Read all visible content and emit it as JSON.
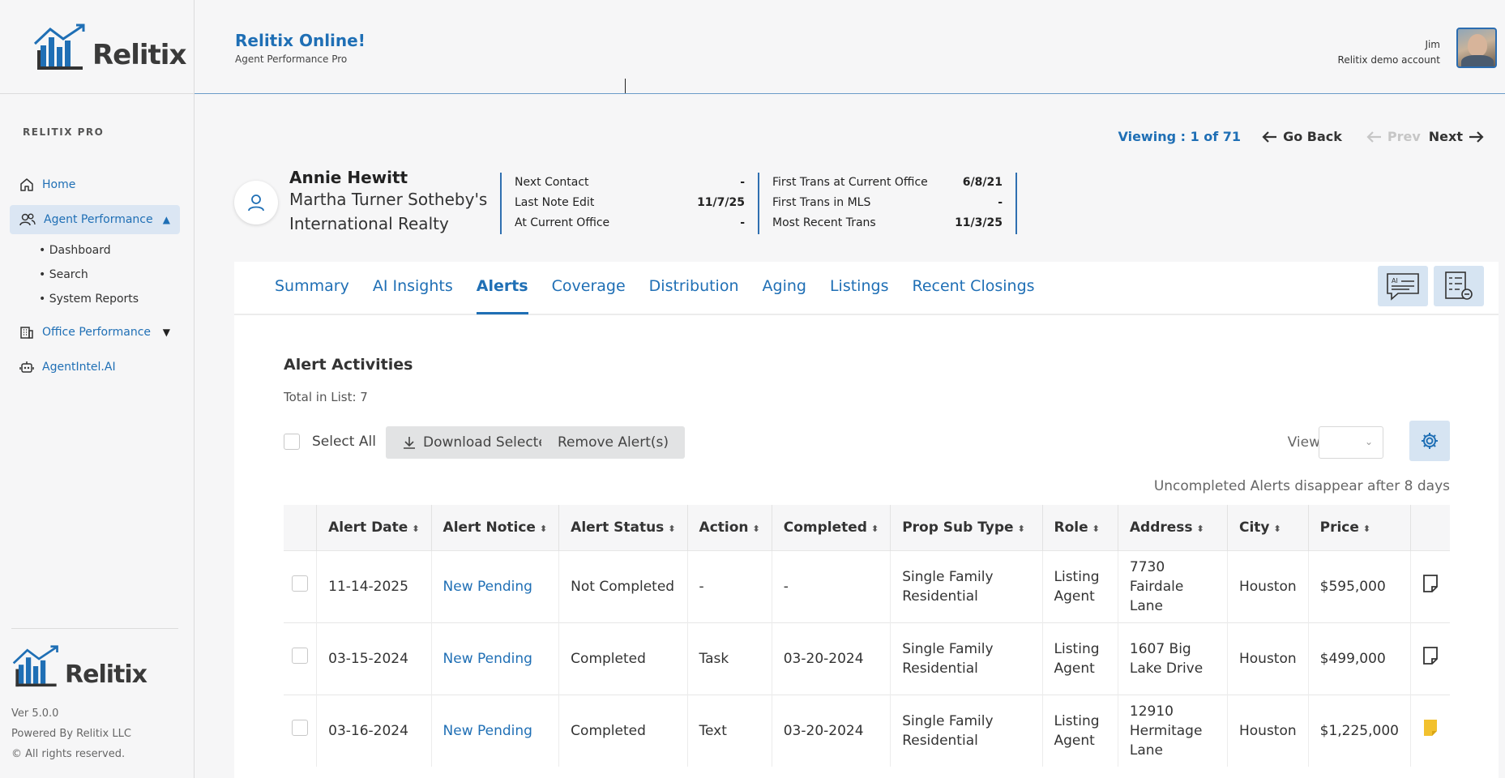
{
  "brand": {
    "logo_text": "Relitix"
  },
  "header": {
    "app_title": "Relitix Online!",
    "app_subtitle": "Agent Performance Pro",
    "user_name": "Jim",
    "user_account": "Relitix demo account"
  },
  "sidebar": {
    "section_title": "RELITIX PRO",
    "items": [
      {
        "label": "Home",
        "icon": "home-icon"
      },
      {
        "label": "Agent Performance",
        "icon": "users-icon",
        "expanded": true
      },
      {
        "label": "Office Performance",
        "icon": "building-icon",
        "expanded": false
      },
      {
        "label": "AgentIntel.AI",
        "icon": "robot-icon"
      }
    ],
    "sub_items": [
      "• Dashboard",
      "• Search",
      "• System Reports"
    ],
    "footer": {
      "version": "Ver 5.0.0",
      "powered": "Powered By Relitix LLC",
      "rights": "© All rights reserved."
    }
  },
  "pager": {
    "viewing": "Viewing : 1 of 71",
    "go_back": "Go Back",
    "prev": "Prev",
    "next": "Next"
  },
  "agent": {
    "name": "Annie Hewitt",
    "office": "Martha Turner Sotheby's International Realty",
    "stats_left": [
      {
        "label": "Next Contact",
        "value": "-"
      },
      {
        "label": "Last Note Edit",
        "value": "11/7/25"
      },
      {
        "label": "At Current Office",
        "value": "-"
      }
    ],
    "stats_right": [
      {
        "label": "First Trans at Current Office",
        "value": "6/8/21"
      },
      {
        "label": "First Trans in MLS",
        "value": "-"
      },
      {
        "label": "Most Recent Trans",
        "value": "11/3/25"
      }
    ]
  },
  "tabs": [
    "Summary",
    "AI Insights",
    "Alerts",
    "Coverage",
    "Distribution",
    "Aging",
    "Listings",
    "Recent Closings"
  ],
  "active_tab": "Alerts",
  "alerts": {
    "title": "Alert Activities",
    "total": "Total in List: 7",
    "select_all": "Select All",
    "download_label": "Download Selected",
    "remove_label": "Remove Alert(s)",
    "view_label": "View",
    "notice": "Uncompleted Alerts disappear after 8 days",
    "columns": [
      "Alert Date",
      "Alert Notice",
      "Alert Status",
      "Action",
      "Completed",
      "Prop Sub Type",
      "Role",
      "Address",
      "City",
      "Price"
    ],
    "rows": [
      {
        "date": "11-14-2025",
        "notice": "New Pending",
        "status": "Not Completed",
        "action": "-",
        "completed": "-",
        "sub_type": "Single Family Residential",
        "role": "Listing Agent",
        "address": "7730 Fairdale Lane",
        "city": "Houston",
        "price": "$595,000",
        "note": "empty"
      },
      {
        "date": "03-15-2024",
        "notice": "New Pending",
        "status": "Completed",
        "action": "Task",
        "completed": "03-20-2024",
        "sub_type": "Single Family Residential",
        "role": "Listing Agent",
        "address": "1607 Big Lake Drive",
        "city": "Houston",
        "price": "$499,000",
        "note": "empty"
      },
      {
        "date": "03-16-2024",
        "notice": "New Pending",
        "status": "Completed",
        "action": "Text",
        "completed": "03-20-2024",
        "sub_type": "Single Family Residential",
        "role": "Listing Agent",
        "address": "12910 Hermitage Lane",
        "city": "Houston",
        "price": "$1,225,000",
        "note": "filled"
      }
    ]
  },
  "colors": {
    "accent": "#1f6fb5",
    "note_filled": "#f2c12e"
  }
}
